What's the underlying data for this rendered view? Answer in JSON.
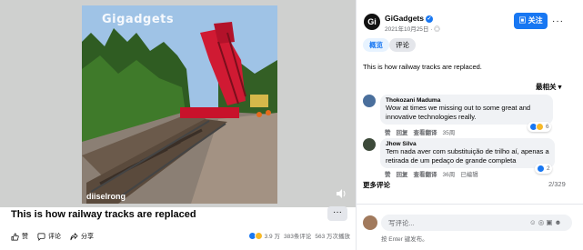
{
  "video": {
    "watermark_top": "Gigadgets",
    "watermark_bottom": "diiselrong",
    "mute_icon": "speaker-icon"
  },
  "post": {
    "title": "This is how railway tracks are replaced",
    "more_label": "···"
  },
  "actions": {
    "like": "赞",
    "comment": "评论",
    "share": "分享"
  },
  "stats": {
    "reactions": "3.9 万",
    "comments": "383条评论",
    "views": "563 万次播放"
  },
  "panel": {
    "page_initial": "Gi",
    "page_name": "GiGadgets",
    "verified_mark": "✓",
    "date": "2021年10月25日 · ",
    "globe_icon": "globe-icon",
    "follow_label": "关注",
    "more_label": "···",
    "tabs": [
      {
        "label": "概览"
      },
      {
        "label": "评论"
      }
    ],
    "description": "This is how railway tracks are replaced.",
    "sort_label": "最相关 ▾"
  },
  "comments": [
    {
      "author": "Thokozani Maduma",
      "text": "Wow at times we missing out to some great and innovative technologies really.",
      "meta": [
        "赞",
        "回复",
        "查看翻译",
        "35周"
      ],
      "reaction_count": "6",
      "avatar_color": "#4a6f9c"
    },
    {
      "author": "Jhow Silva",
      "text": "Tem nada aver com substituição de trilho aí, apenas a retirada de um pedaço de grande completa",
      "meta": [
        "赞",
        "回复",
        "查看翻译",
        "36周",
        "已编辑"
      ],
      "reaction_count": "2",
      "avatar_color": "#3d4a3a"
    }
  ],
  "more_comments": "更多评论",
  "comment_count": "2/329",
  "composer": {
    "placeholder": "写评论...",
    "hint": "按 Enter 键发布。",
    "icons": "☺ ◎ ▣ ☻"
  },
  "colors": {
    "brand": "#1877f2",
    "muted": "#65676b",
    "bubble": "#f0f2f5"
  }
}
